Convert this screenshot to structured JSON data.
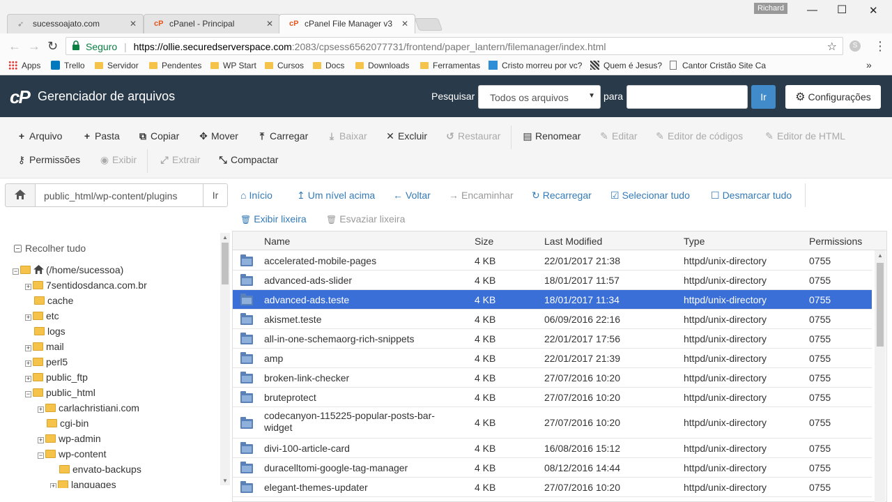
{
  "browser": {
    "tabs": [
      {
        "label": "sucessoajato.com",
        "icon": "plane-icon"
      },
      {
        "label": "cPanel - Principal",
        "icon": "cpanel-icon"
      },
      {
        "label": "cPanel File Manager v3",
        "icon": "cpanel-icon"
      }
    ],
    "user": "Richard",
    "url_secure": "Seguro",
    "url_host": "https://ollie.securedserverspace.com",
    "url_path": ":2083/cpsess6562077731/frontend/paper_lantern/filemanager/index.html",
    "bookmarks": [
      "Apps",
      "Trello",
      "Servidor",
      "Pendentes",
      "WP Start",
      "Cursos",
      "Docs",
      "Downloads",
      "Ferramentas",
      "Cristo morreu por vc?",
      "Quem é Jesus?",
      "Cantor Cristão Site Ca"
    ]
  },
  "header": {
    "logo": "cP",
    "title": "Gerenciador de arquivos",
    "search_label": "Pesquisar",
    "search_scope": "Todos os arquivos",
    "for_label": "para",
    "go_label": "Ir",
    "settings_label": "Configurações"
  },
  "toolbar": {
    "row1": [
      {
        "label": "Arquivo",
        "icon": "+",
        "enabled": true
      },
      {
        "label": "Pasta",
        "icon": "+",
        "enabled": true
      },
      {
        "label": "Copiar",
        "icon": "⧉",
        "enabled": true
      },
      {
        "label": "Mover",
        "icon": "✥",
        "enabled": true
      },
      {
        "label": "Carregar",
        "icon": "⤒",
        "enabled": true
      },
      {
        "label": "Baixar",
        "icon": "⤓",
        "enabled": false
      },
      {
        "label": "Excluir",
        "icon": "✕",
        "enabled": true
      },
      {
        "label": "Restaurar",
        "icon": "↺",
        "enabled": false
      },
      {
        "label": "Renomear",
        "icon": "▤",
        "enabled": true
      },
      {
        "label": "Editar",
        "icon": "✎",
        "enabled": false
      },
      {
        "label": "Editor de códigos",
        "icon": "✎",
        "enabled": false
      },
      {
        "label": "Editor de HTML",
        "icon": "✎",
        "enabled": false
      }
    ],
    "row2": [
      {
        "label": "Permissões",
        "icon": "⚷",
        "enabled": true
      },
      {
        "label": "Exibir",
        "icon": "◉",
        "enabled": false
      },
      {
        "label": "Extrair",
        "icon": "⤢",
        "enabled": false
      },
      {
        "label": "Compactar",
        "icon": "⤡",
        "enabled": true
      }
    ]
  },
  "pathbar": {
    "path": "public_html/wp-content/plugins",
    "go_label": "Ir",
    "nav": [
      {
        "label": "Início",
        "icon": "⌂",
        "enabled": true
      },
      {
        "label": "Um nível acima",
        "icon": "↥",
        "enabled": true
      },
      {
        "label": "Voltar",
        "icon": "←",
        "enabled": true
      },
      {
        "label": "Encaminhar",
        "icon": "→",
        "enabled": false
      },
      {
        "label": "Recarregar",
        "icon": "↻",
        "enabled": true
      },
      {
        "label": "Selecionar tudo",
        "icon": "☑",
        "enabled": true
      },
      {
        "label": "Desmarcar tudo",
        "icon": "☐",
        "enabled": true
      },
      {
        "label": "Exibir lixeira",
        "icon": "🗑",
        "enabled": true
      },
      {
        "label": "Esvaziar lixeira",
        "icon": "🗑",
        "enabled": false
      }
    ]
  },
  "tree": {
    "collapse_label": "Recolher tudo",
    "nodes": [
      {
        "label": "(/home/sucessoa)",
        "level": 0,
        "expander": "-",
        "home": true
      },
      {
        "label": "7sentidosdanca.com.br",
        "level": 1,
        "expander": "+"
      },
      {
        "label": "cache",
        "level": 1,
        "expander": ""
      },
      {
        "label": "etc",
        "level": 1,
        "expander": "+"
      },
      {
        "label": "logs",
        "level": 1,
        "expander": ""
      },
      {
        "label": "mail",
        "level": 1,
        "expander": "+"
      },
      {
        "label": "perl5",
        "level": 1,
        "expander": "+"
      },
      {
        "label": "public_ftp",
        "level": 1,
        "expander": "+"
      },
      {
        "label": "public_html",
        "level": 1,
        "expander": "-"
      },
      {
        "label": "carlachristiani.com",
        "level": 2,
        "expander": "+"
      },
      {
        "label": "cgi-bin",
        "level": 2,
        "expander": ""
      },
      {
        "label": "wp-admin",
        "level": 2,
        "expander": "+"
      },
      {
        "label": "wp-content",
        "level": 2,
        "expander": "-"
      },
      {
        "label": "envato-backups",
        "level": 3,
        "expander": ""
      },
      {
        "label": "languages",
        "level": 3,
        "expander": "+"
      }
    ]
  },
  "table": {
    "columns": [
      "Name",
      "Size",
      "Last Modified",
      "Type",
      "Permissions"
    ],
    "selected_index": 2,
    "rows": [
      {
        "name": "accelerated-mobile-pages",
        "size": "4 KB",
        "modified": "22/01/2017 21:38",
        "type": "httpd/unix-directory",
        "perms": "0755"
      },
      {
        "name": "advanced-ads-slider",
        "size": "4 KB",
        "modified": "18/01/2017 11:57",
        "type": "httpd/unix-directory",
        "perms": "0755"
      },
      {
        "name": "advanced-ads.teste",
        "size": "4 KB",
        "modified": "18/01/2017 11:34",
        "type": "httpd/unix-directory",
        "perms": "0755"
      },
      {
        "name": "akismet.teste",
        "size": "4 KB",
        "modified": "06/09/2016 22:16",
        "type": "httpd/unix-directory",
        "perms": "0755"
      },
      {
        "name": "all-in-one-schemaorg-rich-snippets",
        "size": "4 KB",
        "modified": "22/01/2017 17:56",
        "type": "httpd/unix-directory",
        "perms": "0755"
      },
      {
        "name": "amp",
        "size": "4 KB",
        "modified": "22/01/2017 21:39",
        "type": "httpd/unix-directory",
        "perms": "0755"
      },
      {
        "name": "broken-link-checker",
        "size": "4 KB",
        "modified": "27/07/2016 10:20",
        "type": "httpd/unix-directory",
        "perms": "0755"
      },
      {
        "name": "bruteprotect",
        "size": "4 KB",
        "modified": "27/07/2016 10:20",
        "type": "httpd/unix-directory",
        "perms": "0755"
      },
      {
        "name": "codecanyon-115225-popular-posts-bar-widget",
        "size": "4 KB",
        "modified": "27/07/2016 10:20",
        "type": "httpd/unix-directory",
        "perms": "0755"
      },
      {
        "name": "divi-100-article-card",
        "size": "4 KB",
        "modified": "16/08/2016 15:12",
        "type": "httpd/unix-directory",
        "perms": "0755"
      },
      {
        "name": "duracelltomi-google-tag-manager",
        "size": "4 KB",
        "modified": "08/12/2016 14:44",
        "type": "httpd/unix-directory",
        "perms": "0755"
      },
      {
        "name": "elegant-themes-updater",
        "size": "4 KB",
        "modified": "27/07/2016 10:20",
        "type": "httpd/unix-directory",
        "perms": "0755"
      }
    ]
  }
}
